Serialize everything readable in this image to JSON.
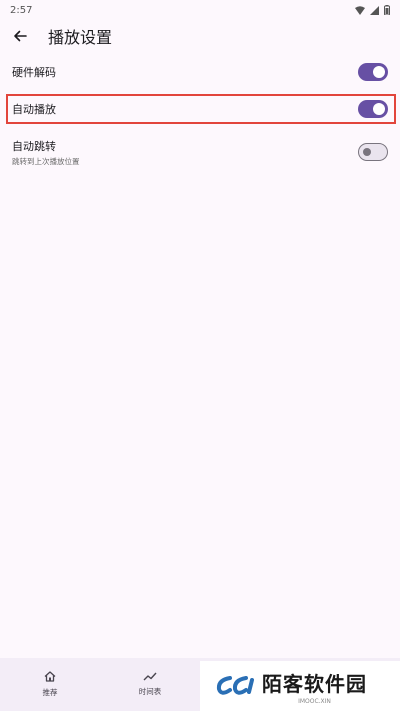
{
  "status": {
    "time": "2:57"
  },
  "appbar": {
    "title": "播放设置"
  },
  "settings": [
    {
      "label": "硬件解码",
      "subtitle": "",
      "enabled": true
    },
    {
      "label": "自动播放",
      "subtitle": "",
      "enabled": true
    },
    {
      "label": "自动跳转",
      "subtitle": "跳转到上次播放位置",
      "enabled": false
    }
  ],
  "nav": [
    {
      "label": "推荐",
      "icon": "home-icon"
    },
    {
      "label": "时间表",
      "icon": "trend-icon"
    }
  ],
  "watermark": {
    "text": "陌客软件园",
    "sub": "IMOOC.XIN"
  },
  "colors": {
    "accent": "#6750a4",
    "highlight": "#e2453c",
    "background": "#fdf8fd"
  }
}
